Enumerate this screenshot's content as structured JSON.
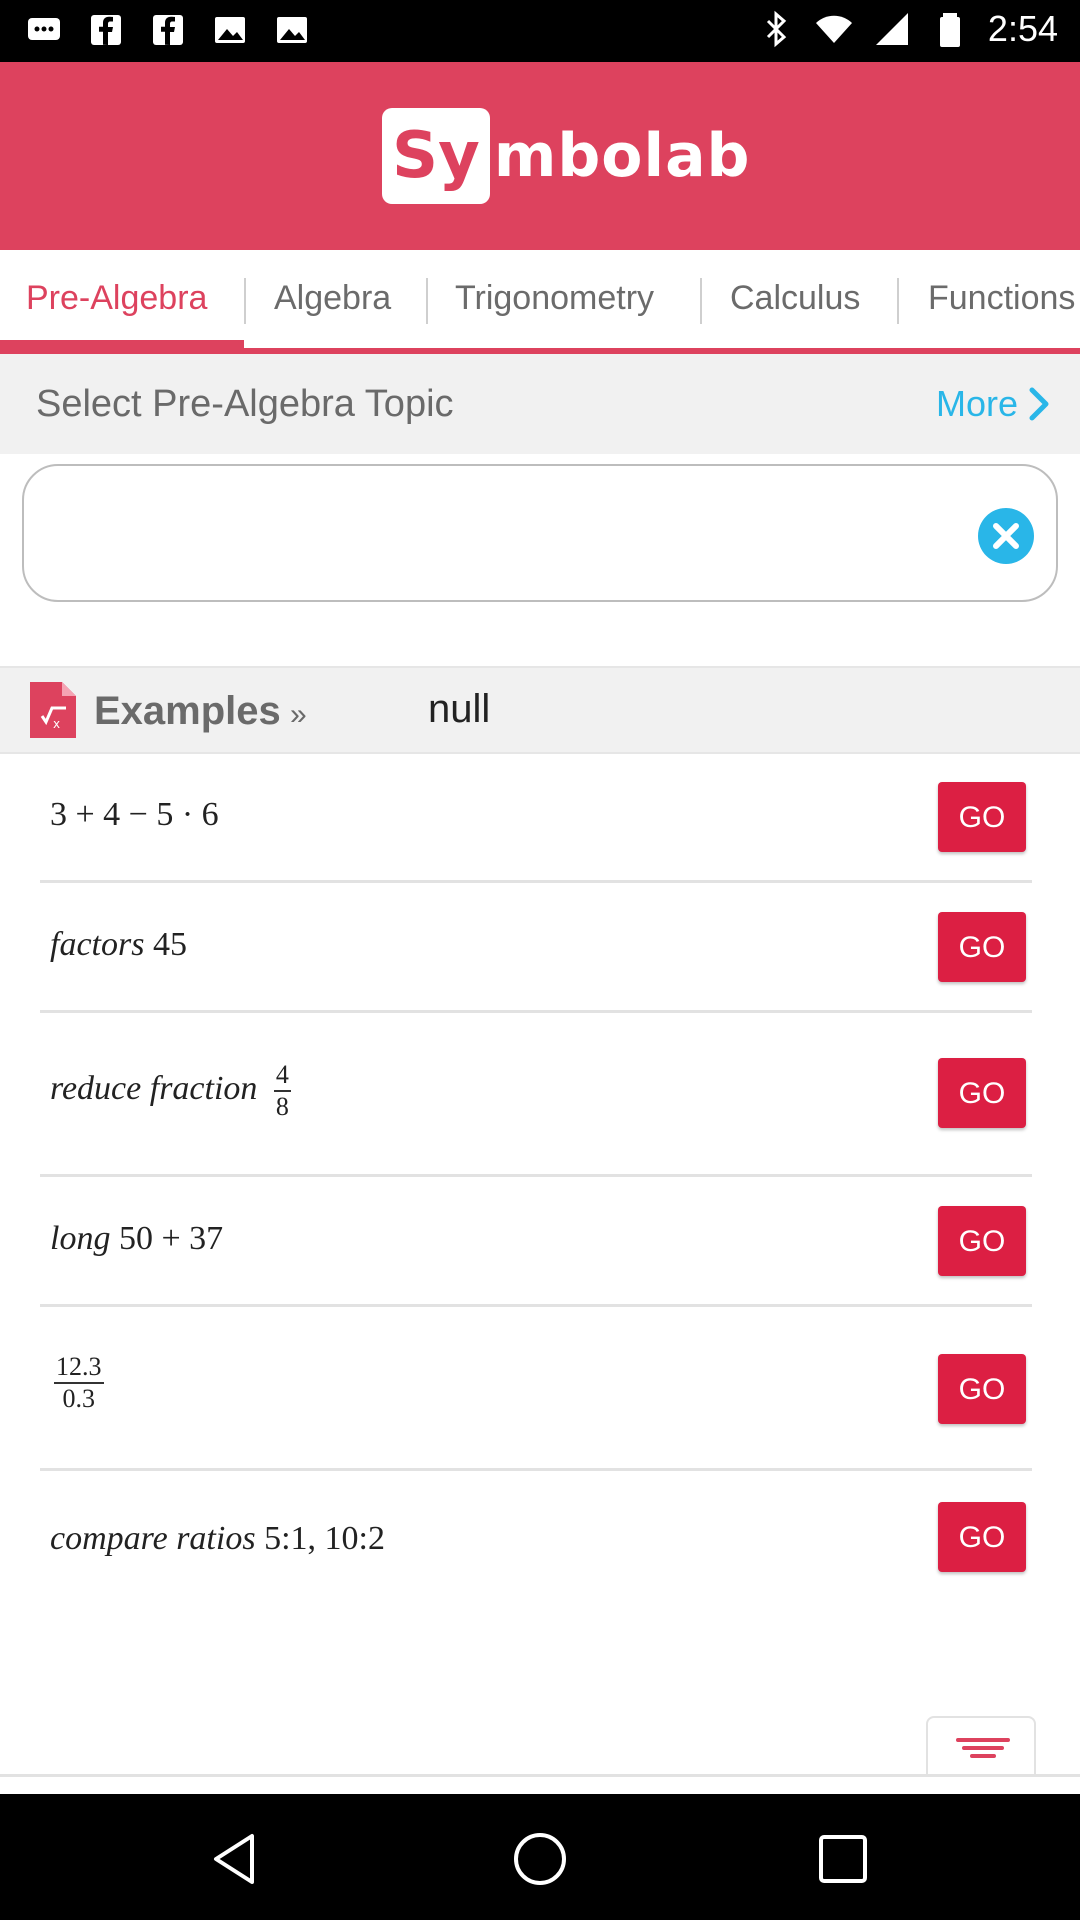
{
  "status_bar": {
    "time": "2:54",
    "left_icons": [
      "chat-icon",
      "facebook-icon",
      "facebook-icon",
      "image-icon",
      "image-icon"
    ],
    "right_icons": [
      "bluetooth-icon",
      "wifi-icon",
      "signal-icon",
      "battery-icon"
    ]
  },
  "header": {
    "logo_box_text": "Sy",
    "logo_rest_text": "mbolab",
    "brand_color": "#dd425e"
  },
  "tabs": [
    {
      "label": "Pre-Algebra",
      "active": true
    },
    {
      "label": "Algebra",
      "active": false
    },
    {
      "label": "Trigonometry",
      "active": false
    },
    {
      "label": "Calculus",
      "active": false
    },
    {
      "label": "Functions",
      "active": false
    }
  ],
  "topic_bar": {
    "title": "Select Pre-Algebra Topic",
    "more_label": "More",
    "link_color": "#29b6e8"
  },
  "input": {
    "value": "",
    "clear_icon": "close-circle-icon"
  },
  "examples": {
    "label": "Examples",
    "arrow": "»",
    "value": "null",
    "icon": "math-document-icon"
  },
  "example_items": [
    {
      "text": "3 + 4 − 5 · 6",
      "button": "GO"
    },
    {
      "italic": "factors",
      "text": " 45",
      "button": "GO"
    },
    {
      "italic": "reduce fraction",
      "num": "4",
      "den": "8",
      "button": "GO"
    },
    {
      "italic": "long",
      "text": " 50 + 37",
      "button": "GO"
    },
    {
      "num": "12.3",
      "den": "0.3",
      "button": "GO"
    },
    {
      "italic": "compare ratios",
      "text": " 5:1, 10:2",
      "button": "GO"
    }
  ],
  "go_button_color": "#dc1f43",
  "bottom": {
    "keypad_icon": "filter-lines-icon"
  },
  "nav_bar": {
    "buttons": [
      "back-icon",
      "home-icon",
      "recents-icon"
    ]
  }
}
